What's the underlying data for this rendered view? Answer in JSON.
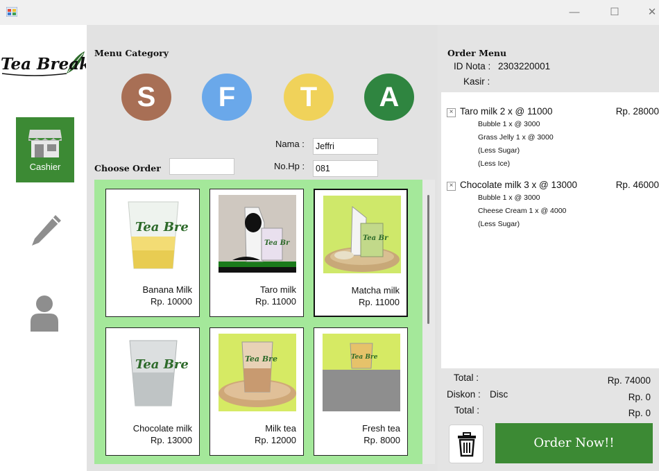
{
  "window": {
    "minimize": "—",
    "maximize": "☐",
    "close": "✕"
  },
  "sidebar": {
    "logo_text": "Tea Break",
    "items": [
      {
        "label": "Cashier",
        "icon": "store-icon",
        "active": true
      },
      {
        "label": "",
        "icon": "pencil-icon",
        "active": false
      },
      {
        "label": "",
        "icon": "user-icon",
        "active": false
      }
    ]
  },
  "main": {
    "menu_category_label": "Menu Category",
    "categories": [
      {
        "letter": "S",
        "color": "#a86f55"
      },
      {
        "letter": "F",
        "color": "#6aa8ea"
      },
      {
        "letter": "T",
        "color": "#f0d25a"
      },
      {
        "letter": "A",
        "color": "#2f8540"
      }
    ],
    "choose_order_label": "Choose Order",
    "choose_order_value": "",
    "nama_label": "Nama :",
    "nama_value": "Jeffri",
    "nohp_label": "No.Hp :",
    "nohp_value": "081",
    "products": [
      {
        "name": "Banana Milk",
        "price": "Rp. 10000",
        "selected": false
      },
      {
        "name": "Taro milk",
        "price": "Rp. 11000",
        "selected": false
      },
      {
        "name": "Matcha milk",
        "price": "Rp. 11000",
        "selected": true
      },
      {
        "name": "Chocolate milk",
        "price": "Rp. 13000",
        "selected": false
      },
      {
        "name": "Milk tea",
        "price": "Rp. 12000",
        "selected": false
      },
      {
        "name": "Fresh tea",
        "price": "Rp. 8000",
        "selected": false
      }
    ]
  },
  "order": {
    "title": "Order Menu",
    "id_nota_label": "ID Nota :",
    "id_nota_value": "2303220001",
    "kasir_label": "Kasir :",
    "kasir_value": "",
    "items": [
      {
        "title": "Taro milk 2 x @ 11000",
        "price": "Rp. 28000",
        "details": [
          "Bubble 1 x @ 3000",
          "Grass Jelly 1 x @ 3000",
          "(Less Sugar)",
          "(Less Ice)"
        ]
      },
      {
        "title": "Chocolate milk 3 x @ 13000",
        "price": "Rp. 46000",
        "details": [
          "Bubble 1 x @ 3000",
          "Cheese Cream 1 x @ 4000",
          "(Less Sugar)"
        ]
      }
    ],
    "total_label": "Total :",
    "total_value": "Rp. 74000",
    "diskon_label": "Diskon :",
    "diskon_name": "Disc",
    "diskon_value": "Rp. 0",
    "grand_total_label": "Total :",
    "grand_total_value": "Rp. 0",
    "order_button": "Order Now!!"
  },
  "colors": {
    "accent_green": "#3c8a34",
    "grid_bg": "#a4e89a"
  }
}
